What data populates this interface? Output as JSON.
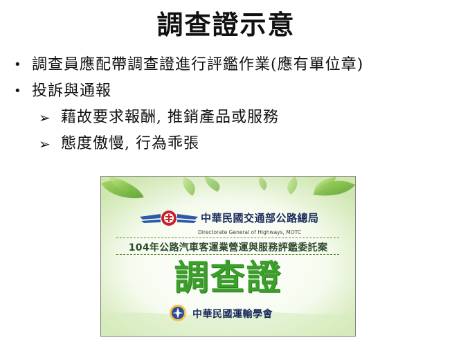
{
  "slide": {
    "title": "調查證示意",
    "bullets": [
      {
        "text": "調查員應配帶調查證進行評鑑作業(應有單位章)",
        "sub": []
      },
      {
        "text": "投訴與通報",
        "sub": [
          "藉故要求報酬, 推銷產品或服務",
          "態度傲慢, 行為乖張"
        ]
      }
    ]
  },
  "card": {
    "agency_name": "中華民國交通部公路總局",
    "agency_name_en": "Directorate General of Highways, MOTC",
    "project": "104年公路汽車客運業營運與服務評鑑委託案",
    "certificate": "調查證",
    "organization": "中華民國運輸學會"
  },
  "colors": {
    "certificate_green": "#3aa02a",
    "agency_navy": "#1a2a5c",
    "logo_red": "#c8202a",
    "logo_blue": "#2a5aa8"
  }
}
